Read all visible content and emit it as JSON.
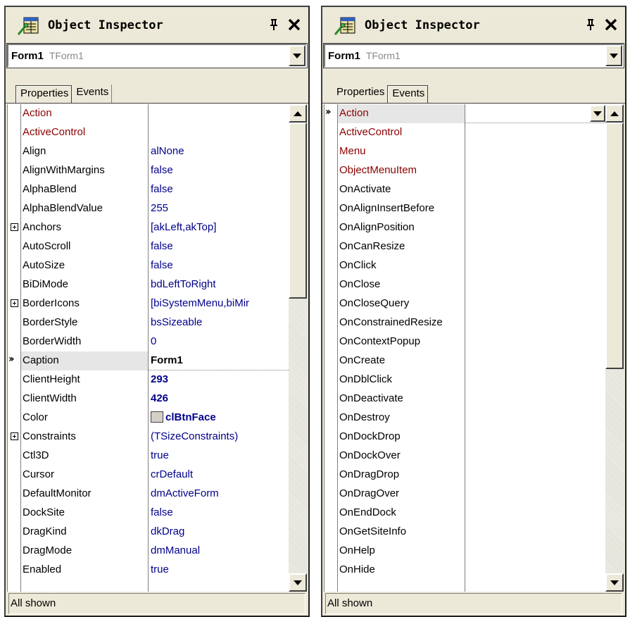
{
  "left": {
    "title": "Object Inspector",
    "selector": {
      "name": "Form1",
      "type": "TForm1"
    },
    "tabs": [
      "Properties",
      "Events"
    ],
    "active_tab": "Properties",
    "rows": [
      {
        "name": "Action",
        "value": "",
        "kind": "ref"
      },
      {
        "name": "ActiveControl",
        "value": "",
        "kind": "ref"
      },
      {
        "name": "Align",
        "value": "alNone"
      },
      {
        "name": "AlignWithMargins",
        "value": "false"
      },
      {
        "name": "AlphaBlend",
        "value": "false"
      },
      {
        "name": "AlphaBlendValue",
        "value": "255"
      },
      {
        "name": "Anchors",
        "value": "[akLeft,akTop]",
        "expandable": true
      },
      {
        "name": "AutoScroll",
        "value": "false"
      },
      {
        "name": "AutoSize",
        "value": "false"
      },
      {
        "name": "BiDiMode",
        "value": "bdLeftToRight"
      },
      {
        "name": "BorderIcons",
        "value": "[biSystemMenu,biMir",
        "expandable": true
      },
      {
        "name": "BorderStyle",
        "value": "bsSizeable"
      },
      {
        "name": "BorderWidth",
        "value": "0"
      },
      {
        "name": "Caption",
        "value": "Form1",
        "selected": true
      },
      {
        "name": "ClientHeight",
        "value": "293",
        "bold": true
      },
      {
        "name": "ClientWidth",
        "value": "426",
        "bold": true
      },
      {
        "name": "Color",
        "value": "clBtnFace",
        "bold": true,
        "swatch": true
      },
      {
        "name": "Constraints",
        "value": "(TSizeConstraints)",
        "expandable": true
      },
      {
        "name": "Ctl3D",
        "value": "true"
      },
      {
        "name": "Cursor",
        "value": "crDefault"
      },
      {
        "name": "DefaultMonitor",
        "value": "dmActiveForm"
      },
      {
        "name": "DockSite",
        "value": "false"
      },
      {
        "name": "DragKind",
        "value": "dkDrag"
      },
      {
        "name": "DragMode",
        "value": "dmManual"
      },
      {
        "name": "Enabled",
        "value": "true"
      }
    ],
    "status": "All shown"
  },
  "right": {
    "title": "Object Inspector",
    "selector": {
      "name": "Form1",
      "type": "TForm1"
    },
    "tabs": [
      "Properties",
      "Events"
    ],
    "active_tab": "Events",
    "rows": [
      {
        "name": "Action",
        "value": "",
        "kind": "ref",
        "selected": true
      },
      {
        "name": "ActiveControl",
        "value": "",
        "kind": "ref"
      },
      {
        "name": "Menu",
        "value": "",
        "kind": "ref"
      },
      {
        "name": "ObjectMenuItem",
        "value": "",
        "kind": "ref"
      },
      {
        "name": "OnActivate",
        "value": ""
      },
      {
        "name": "OnAlignInsertBefore",
        "value": ""
      },
      {
        "name": "OnAlignPosition",
        "value": ""
      },
      {
        "name": "OnCanResize",
        "value": ""
      },
      {
        "name": "OnClick",
        "value": ""
      },
      {
        "name": "OnClose",
        "value": ""
      },
      {
        "name": "OnCloseQuery",
        "value": ""
      },
      {
        "name": "OnConstrainedResize",
        "value": ""
      },
      {
        "name": "OnContextPopup",
        "value": ""
      },
      {
        "name": "OnCreate",
        "value": ""
      },
      {
        "name": "OnDblClick",
        "value": ""
      },
      {
        "name": "OnDeactivate",
        "value": ""
      },
      {
        "name": "OnDestroy",
        "value": ""
      },
      {
        "name": "OnDockDrop",
        "value": ""
      },
      {
        "name": "OnDockOver",
        "value": ""
      },
      {
        "name": "OnDragDrop",
        "value": ""
      },
      {
        "name": "OnDragOver",
        "value": ""
      },
      {
        "name": "OnEndDock",
        "value": ""
      },
      {
        "name": "OnGetSiteInfo",
        "value": ""
      },
      {
        "name": "OnHelp",
        "value": ""
      },
      {
        "name": "OnHide",
        "value": ""
      }
    ],
    "status": "All shown"
  },
  "icons": {
    "title": "object-inspector-icon",
    "pin": "pin-icon",
    "close": "close-icon",
    "expand": "expand-plus-icon",
    "current": "double-chevron-right-icon"
  },
  "colors": {
    "reference_name": "#8b0000",
    "value_text": "#00008b",
    "panel_bg": "#ece9d8",
    "selected_row": "#e6e6e6",
    "color_swatch": "#d4d0c8"
  }
}
